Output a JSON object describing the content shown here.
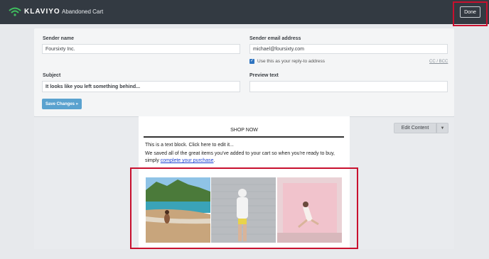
{
  "header": {
    "logo_text": "KLAVIYO",
    "title": "Abandoned Cart",
    "done_label": "Done"
  },
  "form": {
    "sender_name_label": "Sender name",
    "sender_name_value": "Foursixty Inc.",
    "sender_email_label": "Sender email address",
    "sender_email_value": "michael@foursixty.com",
    "reply_to_label": "Use this as your reply-to address",
    "cc_bcc_label": "CC / BCC",
    "subject_label": "Subject",
    "subject_value": "It looks like you left something behind...",
    "preview_label": "Preview text",
    "preview_value": "",
    "save_label": "Save Changes »"
  },
  "email": {
    "shop_now": "SHOP NOW",
    "text_block": "This is a text block. Click here to edit it...",
    "body_line1": "We saved all of the great items you've added to your cart so when you're ready to buy,",
    "body_line2_prefix": "simply ",
    "body_link": "complete your purchase",
    "body_line2_suffix": "."
  },
  "editor": {
    "edit_content_label": "Edit Content"
  },
  "colors": {
    "topbar": "#333a42",
    "accent_button": "#5aa2cf",
    "highlight_red": "#c8102e",
    "link_blue": "#1a3fd1"
  },
  "icons": {
    "logo": "wifi-flag-icon",
    "checkbox": "check-icon",
    "dropdown": "chevron-down-icon"
  }
}
